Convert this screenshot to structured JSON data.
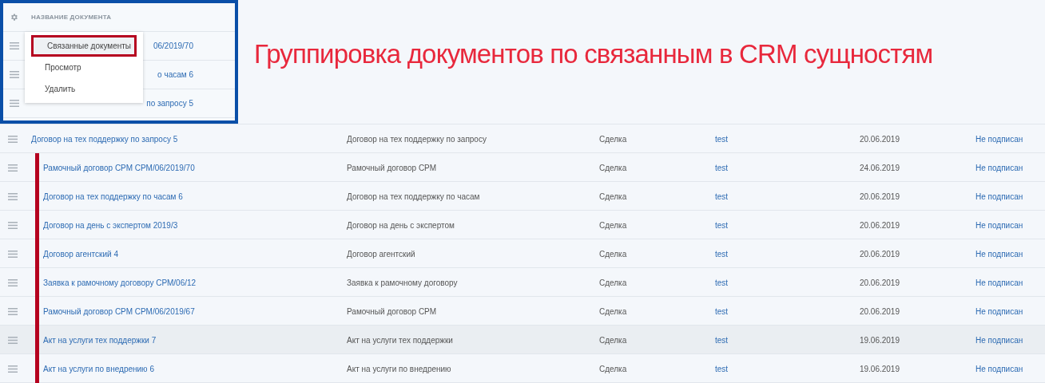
{
  "header": {
    "column_title": "НАЗВАНИЕ ДОКУМЕНТА"
  },
  "top_rows": [
    {
      "title": "06/2019/70"
    },
    {
      "title": "о часам 6"
    },
    {
      "title": "по запросу 5"
    }
  ],
  "context_menu": {
    "items": [
      {
        "label": "Связанные документы",
        "selected": true,
        "highlighted": true
      },
      {
        "label": "Просмотр",
        "selected": false,
        "highlighted": false
      },
      {
        "label": "Удалить",
        "selected": false,
        "highlighted": false
      }
    ]
  },
  "annotation": {
    "title": "Группировка документов по связанным в CRM сущностям"
  },
  "rows": [
    {
      "name": "Договор на тех поддержку по запросу 5",
      "type": "Договор на тех поддержку по запросу",
      "entity": "Сделка",
      "author": "test",
      "date": "20.06.2019",
      "status": "Не подписан",
      "grouped": false,
      "hovered": false
    },
    {
      "name": "Рамочный договор СРМ СРМ/06/2019/70",
      "type": "Рамочный договор СРМ",
      "entity": "Сделка",
      "author": "test",
      "date": "24.06.2019",
      "status": "Не подписан",
      "grouped": true,
      "hovered": false
    },
    {
      "name": "Договор на тех поддержку по часам 6",
      "type": "Договор на тех поддержку по часам",
      "entity": "Сделка",
      "author": "test",
      "date": "20.06.2019",
      "status": "Не подписан",
      "grouped": true,
      "hovered": false
    },
    {
      "name": "Договор на день с экспертом 2019/3",
      "type": "Договор на день с экспертом",
      "entity": "Сделка",
      "author": "test",
      "date": "20.06.2019",
      "status": "Не подписан",
      "grouped": true,
      "hovered": false
    },
    {
      "name": "Договор агентский 4",
      "type": "Договор агентский",
      "entity": "Сделка",
      "author": "test",
      "date": "20.06.2019",
      "status": "Не подписан",
      "grouped": true,
      "hovered": false
    },
    {
      "name": "Заявка к рамочному договору СРМ/06/12",
      "type": "Заявка к рамочному договору",
      "entity": "Сделка",
      "author": "test",
      "date": "20.06.2019",
      "status": "Не подписан",
      "grouped": true,
      "hovered": false
    },
    {
      "name": "Рамочный договор СРМ СРМ/06/2019/67",
      "type": "Рамочный договор СРМ",
      "entity": "Сделка",
      "author": "test",
      "date": "20.06.2019",
      "status": "Не подписан",
      "grouped": true,
      "hovered": false
    },
    {
      "name": "Акт на услуги тех поддержки 7",
      "type": "Акт на услуги тех поддержки",
      "entity": "Сделка",
      "author": "test",
      "date": "19.06.2019",
      "status": "Не подписан",
      "grouped": true,
      "hovered": true
    },
    {
      "name": "Акт на услуги по внедрению 6",
      "type": "Акт на услуги по внедрению",
      "entity": "Сделка",
      "author": "test",
      "date": "19.06.2019",
      "status": "Не подписан",
      "grouped": true,
      "hovered": false
    }
  ]
}
